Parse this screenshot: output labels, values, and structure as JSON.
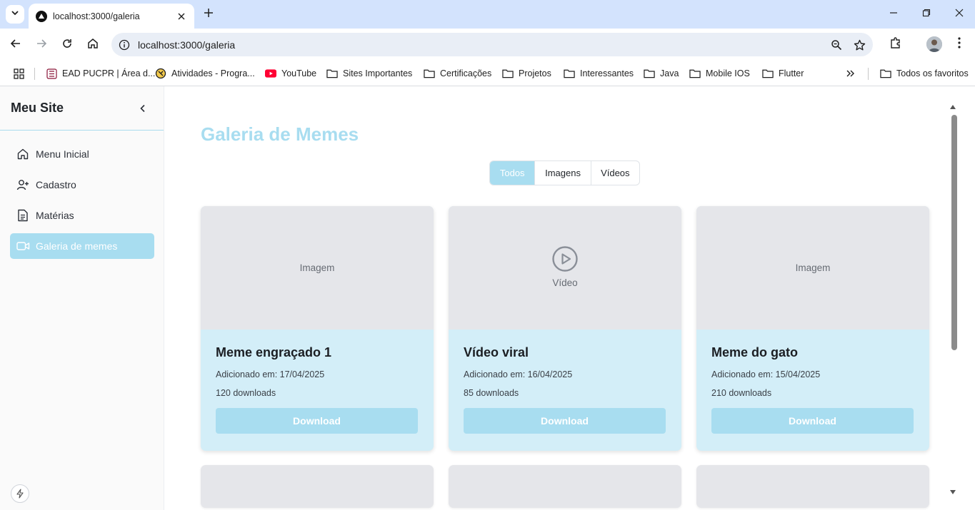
{
  "browser": {
    "tab_title": "localhost:3000/galeria",
    "url": "localhost:3000/galeria",
    "bookmarks": [
      {
        "label": "EAD PUCPR | Área d...",
        "icon": "pucpr-icon"
      },
      {
        "label": "Atividades - Progra...",
        "icon": "site-icon"
      },
      {
        "label": "YouTube",
        "icon": "youtube-icon"
      },
      {
        "label": "Sites Importantes",
        "icon": "folder-icon"
      },
      {
        "label": "Certificações",
        "icon": "folder-icon"
      },
      {
        "label": "Projetos",
        "icon": "folder-icon"
      },
      {
        "label": "Interessantes",
        "icon": "folder-icon"
      },
      {
        "label": "Java",
        "icon": "folder-icon"
      },
      {
        "label": "Mobile IOS",
        "icon": "folder-icon"
      },
      {
        "label": "Flutter",
        "icon": "folder-icon"
      }
    ],
    "all_bookmarks": "Todos os favoritos"
  },
  "sidebar": {
    "title": "Meu Site",
    "items": [
      {
        "label": "Menu Inicial",
        "icon": "home-icon",
        "active": false
      },
      {
        "label": "Cadastro",
        "icon": "user-plus-icon",
        "active": false
      },
      {
        "label": "Matérias",
        "icon": "document-icon",
        "active": false
      },
      {
        "label": "Galeria de memes",
        "icon": "video-icon",
        "active": true
      }
    ]
  },
  "main": {
    "title": "Galeria de Memes",
    "filters": [
      {
        "label": "Todos",
        "active": true
      },
      {
        "label": "Imagens",
        "active": false
      },
      {
        "label": "Vídeos",
        "active": false
      }
    ],
    "cards": [
      {
        "media_label": "Imagem",
        "type": "image",
        "title": "Meme engraçado 1",
        "date": "Adicionado em: 17/04/2025",
        "downloads": "120 downloads",
        "button": "Download"
      },
      {
        "media_label": "Vídeo",
        "type": "video",
        "title": "Vídeo viral",
        "date": "Adicionado em: 16/04/2025",
        "downloads": "85 downloads",
        "button": "Download"
      },
      {
        "media_label": "Imagem",
        "type": "image",
        "title": "Meme do gato",
        "date": "Adicionado em: 15/04/2025",
        "downloads": "210 downloads",
        "button": "Download"
      }
    ]
  },
  "colors": {
    "accent": "#a8ddf0",
    "card_bg": "#d3eef8",
    "media_bg": "#e5e6ea",
    "chrome_bg": "#d3e3fd"
  }
}
